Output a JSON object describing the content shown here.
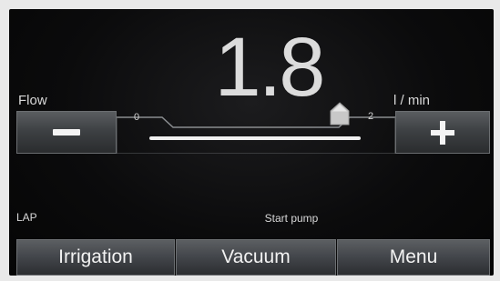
{
  "display": {
    "flow_value": "1.8",
    "flow_label": "Flow",
    "unit_label": "l / min"
  },
  "slider": {
    "min_label": "0",
    "max_label": "2",
    "level": 0.9
  },
  "controls": {
    "decrease_icon": "minus-icon",
    "increase_icon": "plus-icon"
  },
  "status": {
    "mode_label": "LAP",
    "message": "Start pump"
  },
  "nav": {
    "irrigation": "Irrigation",
    "vacuum": "Vacuum",
    "menu": "Menu"
  },
  "colors": {
    "background": "#0b0b0c",
    "button": "#42454a",
    "text": "#e6e6e6"
  }
}
